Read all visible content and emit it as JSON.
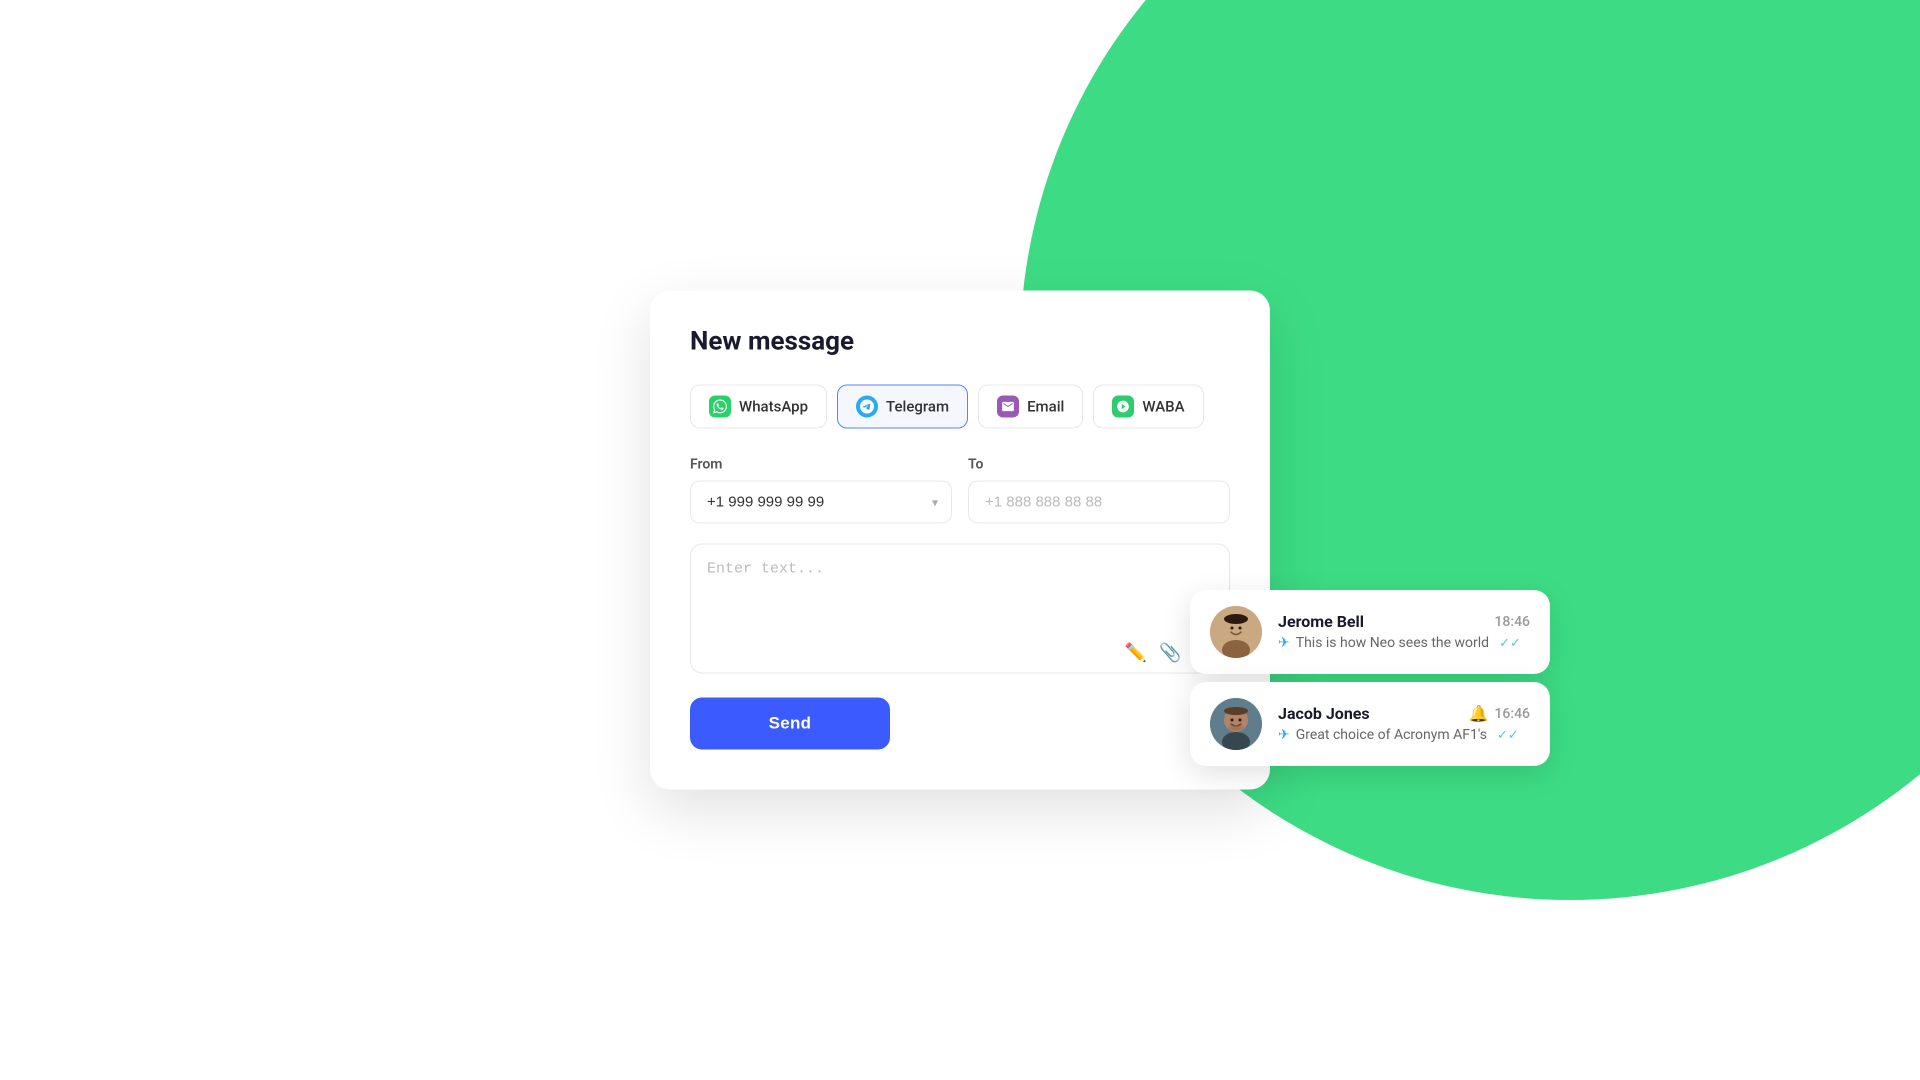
{
  "background": {
    "circle_color": "#3DDC84"
  },
  "card": {
    "title": "New message",
    "channels": [
      {
        "id": "whatsapp",
        "label": "WhatsApp",
        "icon_type": "whatsapp",
        "active": false
      },
      {
        "id": "telegram",
        "label": "Telegram",
        "icon_type": "telegram",
        "active": true
      },
      {
        "id": "email",
        "label": "Email",
        "icon_type": "email",
        "active": false
      },
      {
        "id": "waba",
        "label": "WABA",
        "icon_type": "waba",
        "active": false
      }
    ],
    "from_label": "From",
    "from_value": "+1 999 999 99 99",
    "to_label": "To",
    "to_placeholder": "+1 888 888 88 88",
    "text_placeholder": "Enter text...",
    "send_button_label": "Send"
  },
  "notifications": [
    {
      "id": "jerome",
      "name": "Jerome Bell",
      "time": "18:46",
      "message": "This is how Neo sees the world",
      "channel_icon": "telegram",
      "has_bell": false,
      "check_marks": "✓✓"
    },
    {
      "id": "jacob",
      "name": "Jacob Jones",
      "time": "16:46",
      "message": "Great choice of Acronym AF1's",
      "channel_icon": "telegram",
      "has_bell": true,
      "check_marks": "✓✓"
    }
  ]
}
